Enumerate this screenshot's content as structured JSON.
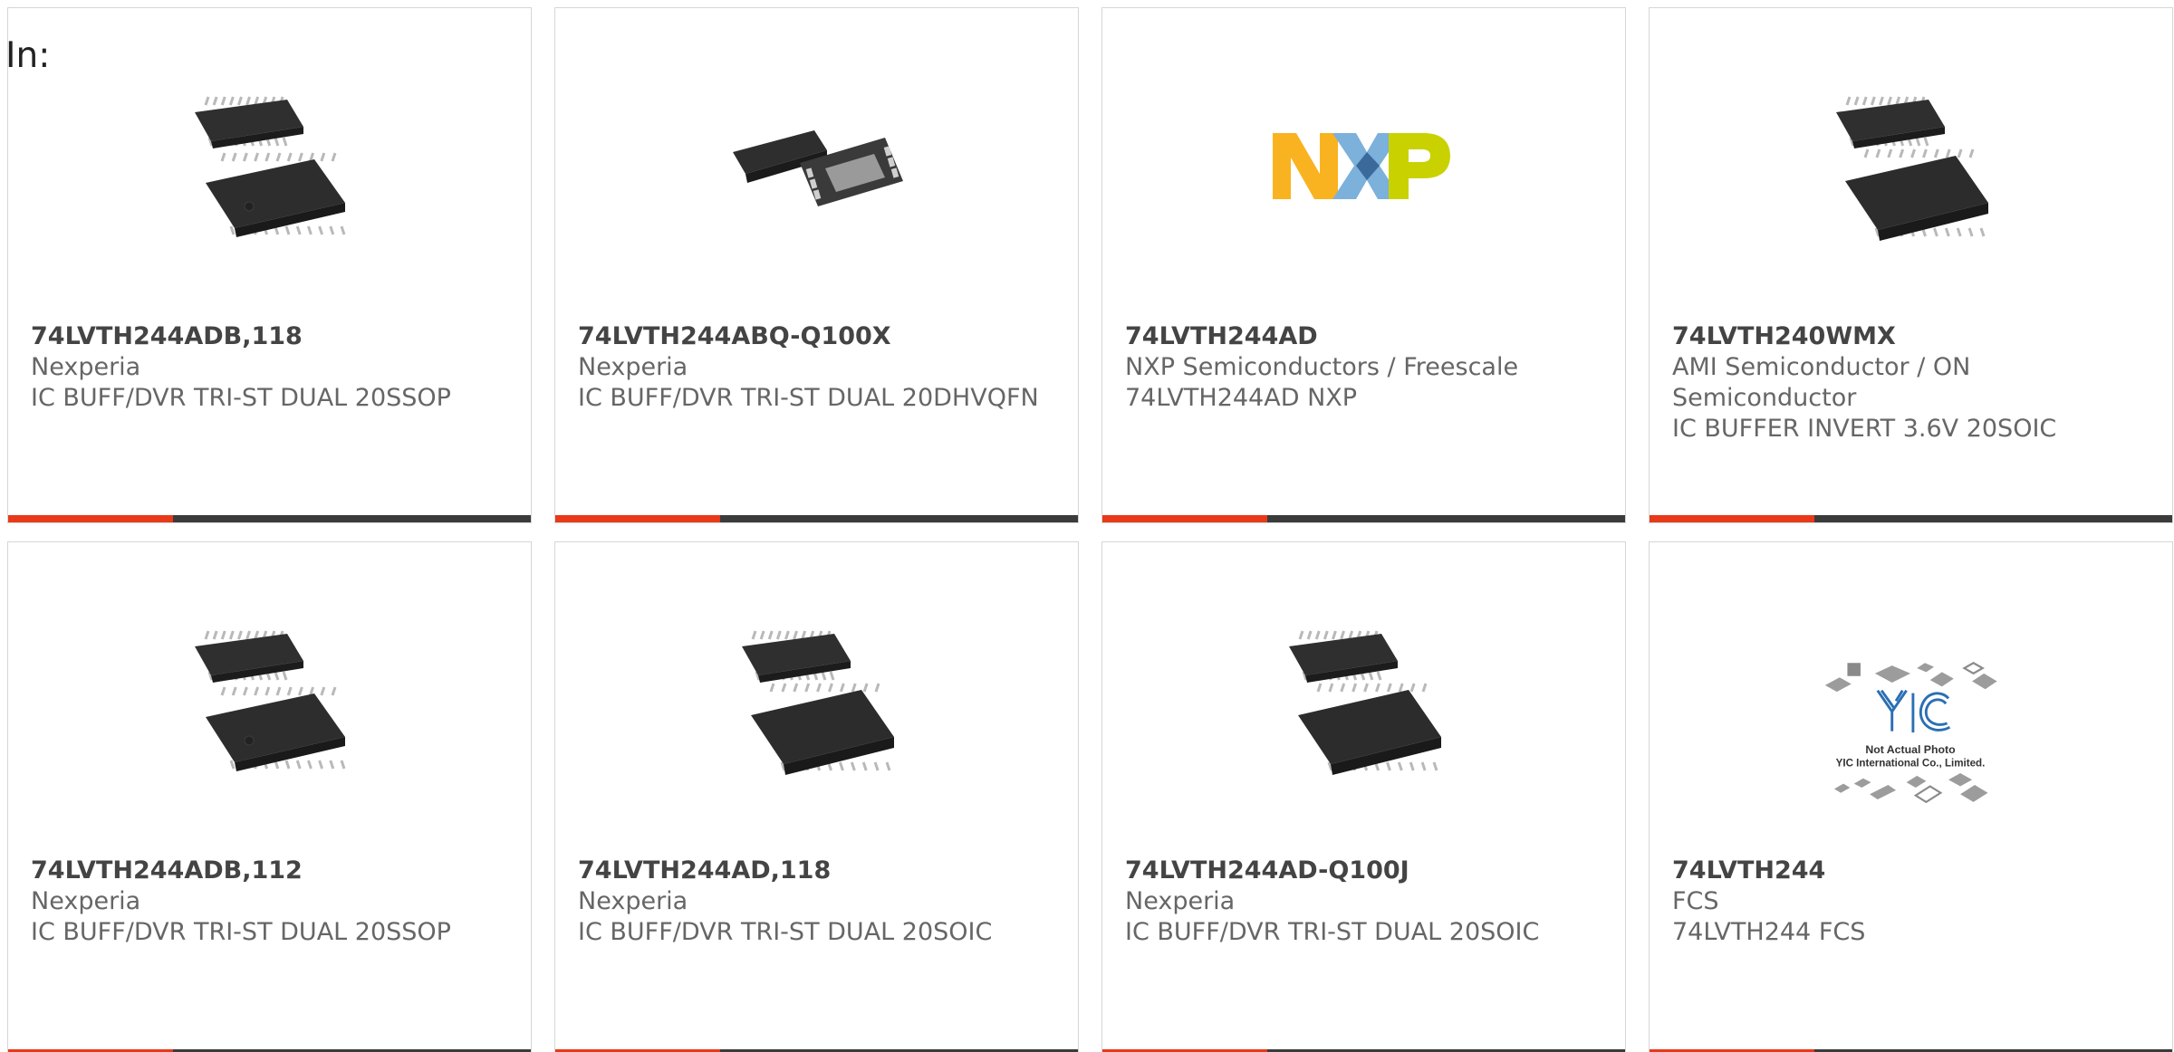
{
  "header": {
    "prefix": "In:"
  },
  "colors": {
    "accent": "#e8391a",
    "bar": "#3b3b3b",
    "border": "#d6d6d6"
  },
  "products": [
    {
      "part": "74LVTH244ADB,118",
      "manufacturer": "Nexperia",
      "description": "IC BUFF/DVR TRI-ST DUAL 20SSOP",
      "image": "ssop-chip-icon"
    },
    {
      "part": "74LVTH244ABQ-Q100X",
      "manufacturer": "Nexperia",
      "description": "IC BUFF/DVR TRI-ST DUAL 20DHVQFN",
      "image": "qfn-chip-icon"
    },
    {
      "part": "74LVTH244AD",
      "manufacturer": "NXP Semiconductors / Freescale",
      "description": "74LVTH244AD NXP",
      "image": "nxp-logo"
    },
    {
      "part": "74LVTH240WMX",
      "manufacturer": "AMI Semiconductor / ON Semiconductor",
      "description": "IC BUFFER INVERT 3.6V 20SOIC",
      "image": "soic-chip-icon"
    },
    {
      "part": "74LVTH244ADB,112",
      "manufacturer": "Nexperia",
      "description": "IC BUFF/DVR TRI-ST DUAL 20SSOP",
      "image": "ssop-chip-icon"
    },
    {
      "part": "74LVTH244AD,118",
      "manufacturer": "Nexperia",
      "description": "IC BUFF/DVR TRI-ST DUAL 20SOIC",
      "image": "soic-chip-icon"
    },
    {
      "part": "74LVTH244AD-Q100J",
      "manufacturer": "Nexperia",
      "description": "IC BUFF/DVR TRI-ST DUAL 20SOIC",
      "image": "soic-chip-icon"
    },
    {
      "part": "74LVTH244",
      "manufacturer": "FCS",
      "description": "74LVTH244 FCS",
      "image": "yic-placeholder-logo",
      "placeholder_text": [
        "Not Actual Photo",
        "YIC International Co., Limited."
      ],
      "placeholder_mark": "YIC"
    }
  ]
}
